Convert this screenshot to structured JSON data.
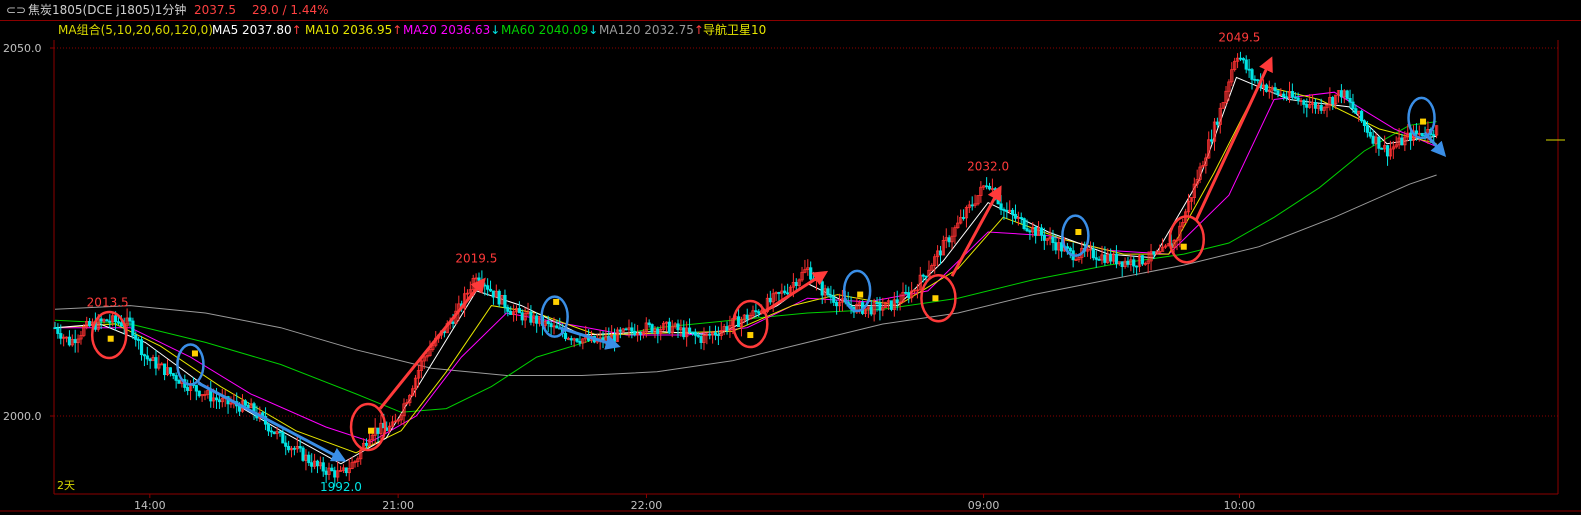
{
  "header": {
    "icon": "window-toggle-icon",
    "contract": "焦炭1805(DCE j1805)1分钟",
    "last_price": "2037.5",
    "change": "29.0 / 1.44%"
  },
  "indicators": {
    "group_label": "MA组合(5,10,20,60,120,0)",
    "ma5": "MA5 2037.80",
    "ma5_arrow": "↑",
    "ma10": "MA10 2036.95",
    "ma10_arrow": "↑",
    "ma20": "MA20 2036.63",
    "ma20_arrow": "↓",
    "ma60": "MA60 2040.09",
    "ma60_arrow": "↓",
    "ma120": "MA120 2032.75",
    "ma120_arrow": "↑",
    "nav_label": "导航卫星10"
  },
  "footer": {
    "period_label": "2天"
  },
  "colors": {
    "up": "#ff3232",
    "down": "#00e5e5",
    "ma5": "#ffffff",
    "ma10": "#e6e600",
    "ma20": "#ff00ff",
    "ma60": "#00d000",
    "ma120": "#9a9a9a",
    "axis": "#8b0000",
    "red_annotation": "#ff3a3a",
    "blue_annotation": "#3a8ee6",
    "title_red": "#ff4040",
    "label_yellow": "#d8d800"
  },
  "chart_data": {
    "type": "candlestick",
    "title": "焦炭1805(DCE j1805)1分钟",
    "ylim": [
      1988,
      2054
    ],
    "y_ticks": [
      {
        "value": 2050,
        "label": "2050.0"
      },
      {
        "value": 2000,
        "label": "2000.0"
      }
    ],
    "x_ticks": [
      {
        "pos": 0.063,
        "label": "14:00"
      },
      {
        "pos": 0.228,
        "label": "21:00"
      },
      {
        "pos": 0.393,
        "label": "22:00"
      },
      {
        "pos": 0.617,
        "label": "09:00"
      },
      {
        "pos": 0.787,
        "label": "10:00"
      }
    ],
    "price_path": [
      [
        0.0,
        2012
      ],
      [
        0.01,
        2010
      ],
      [
        0.02,
        2012
      ],
      [
        0.035,
        2013
      ],
      [
        0.05,
        2012.5
      ],
      [
        0.06,
        2008
      ],
      [
        0.09,
        2004
      ],
      [
        0.11,
        2002
      ],
      [
        0.13,
        2001
      ],
      [
        0.15,
        1997
      ],
      [
        0.175,
        1993
      ],
      [
        0.19,
        1992
      ],
      [
        0.2,
        1994
      ],
      [
        0.21,
        1998
      ],
      [
        0.225,
        1998.5
      ],
      [
        0.235,
        2003
      ],
      [
        0.245,
        2008
      ],
      [
        0.26,
        2012
      ],
      [
        0.27,
        2015
      ],
      [
        0.28,
        2019.5
      ],
      [
        0.29,
        2017
      ],
      [
        0.305,
        2014
      ],
      [
        0.32,
        2013
      ],
      [
        0.34,
        2011
      ],
      [
        0.36,
        2010
      ],
      [
        0.375,
        2011
      ],
      [
        0.39,
        2012
      ],
      [
        0.41,
        2012
      ],
      [
        0.43,
        2010.5
      ],
      [
        0.445,
        2012
      ],
      [
        0.465,
        2014
      ],
      [
        0.485,
        2017
      ],
      [
        0.5,
        2020
      ],
      [
        0.51,
        2017
      ],
      [
        0.525,
        2015
      ],
      [
        0.54,
        2014.5
      ],
      [
        0.555,
        2015
      ],
      [
        0.57,
        2017
      ],
      [
        0.59,
        2023
      ],
      [
        0.61,
        2029
      ],
      [
        0.62,
        2032
      ],
      [
        0.63,
        2028
      ],
      [
        0.645,
        2026
      ],
      [
        0.66,
        2024
      ],
      [
        0.675,
        2022
      ],
      [
        0.69,
        2022
      ],
      [
        0.71,
        2021
      ],
      [
        0.72,
        2021
      ],
      [
        0.735,
        2022
      ],
      [
        0.745,
        2024
      ],
      [
        0.755,
        2030
      ],
      [
        0.765,
        2036
      ],
      [
        0.775,
        2042
      ],
      [
        0.785,
        2049.5
      ],
      [
        0.795,
        2046
      ],
      [
        0.81,
        2044
      ],
      [
        0.825,
        2043
      ],
      [
        0.84,
        2042
      ],
      [
        0.855,
        2044
      ],
      [
        0.865,
        2041
      ],
      [
        0.875,
        2038
      ],
      [
        0.885,
        2036
      ],
      [
        0.9,
        2038
      ],
      [
        0.918,
        2039
      ]
    ],
    "ma5_path": [
      [
        0.0,
        2012
      ],
      [
        0.03,
        2012.5
      ],
      [
        0.06,
        2010
      ],
      [
        0.1,
        2004
      ],
      [
        0.15,
        1998
      ],
      [
        0.19,
        1993.5
      ],
      [
        0.22,
        1997
      ],
      [
        0.25,
        2007
      ],
      [
        0.28,
        2017
      ],
      [
        0.31,
        2015
      ],
      [
        0.35,
        2011
      ],
      [
        0.4,
        2011.5
      ],
      [
        0.44,
        2011
      ],
      [
        0.48,
        2015
      ],
      [
        0.5,
        2018
      ],
      [
        0.53,
        2015
      ],
      [
        0.56,
        2015
      ],
      [
        0.59,
        2021
      ],
      [
        0.62,
        2029
      ],
      [
        0.66,
        2025
      ],
      [
        0.7,
        2022
      ],
      [
        0.73,
        2021.5
      ],
      [
        0.76,
        2032
      ],
      [
        0.785,
        2046
      ],
      [
        0.82,
        2043
      ],
      [
        0.86,
        2042
      ],
      [
        0.885,
        2037
      ],
      [
        0.918,
        2038
      ]
    ],
    "ma10_path": [
      [
        0.0,
        2012
      ],
      [
        0.04,
        2012.5
      ],
      [
        0.07,
        2009.5
      ],
      [
        0.11,
        2004
      ],
      [
        0.16,
        1998
      ],
      [
        0.2,
        1995
      ],
      [
        0.23,
        1998
      ],
      [
        0.26,
        2006
      ],
      [
        0.29,
        2015
      ],
      [
        0.32,
        2014
      ],
      [
        0.36,
        2011
      ],
      [
        0.41,
        2011.3
      ],
      [
        0.45,
        2011.5
      ],
      [
        0.49,
        2015
      ],
      [
        0.52,
        2016.5
      ],
      [
        0.56,
        2015
      ],
      [
        0.6,
        2020
      ],
      [
        0.63,
        2027
      ],
      [
        0.67,
        2024
      ],
      [
        0.71,
        2022
      ],
      [
        0.74,
        2022
      ],
      [
        0.77,
        2033
      ],
      [
        0.8,
        2045
      ],
      [
        0.84,
        2043
      ],
      [
        0.88,
        2039
      ],
      [
        0.918,
        2037
      ]
    ],
    "ma20_path": [
      [
        0.0,
        2012
      ],
      [
        0.05,
        2012
      ],
      [
        0.09,
        2008
      ],
      [
        0.13,
        2003
      ],
      [
        0.18,
        1998.5
      ],
      [
        0.21,
        1996.5
      ],
      [
        0.24,
        2000
      ],
      [
        0.27,
        2008
      ],
      [
        0.3,
        2014
      ],
      [
        0.34,
        2012.5
      ],
      [
        0.38,
        2011
      ],
      [
        0.42,
        2011
      ],
      [
        0.46,
        2012
      ],
      [
        0.5,
        2016
      ],
      [
        0.54,
        2015.5
      ],
      [
        0.58,
        2017
      ],
      [
        0.62,
        2025
      ],
      [
        0.66,
        2024.5
      ],
      [
        0.7,
        2022.5
      ],
      [
        0.74,
        2022
      ],
      [
        0.78,
        2030
      ],
      [
        0.81,
        2043
      ],
      [
        0.85,
        2044
      ],
      [
        0.89,
        2039
      ],
      [
        0.918,
        2036.6
      ]
    ],
    "ma60_path": [
      [
        0.0,
        2013
      ],
      [
        0.05,
        2012.5
      ],
      [
        0.1,
        2010
      ],
      [
        0.15,
        2007
      ],
      [
        0.2,
        2003
      ],
      [
        0.23,
        2000.5
      ],
      [
        0.26,
        2001
      ],
      [
        0.29,
        2004
      ],
      [
        0.32,
        2008
      ],
      [
        0.36,
        2010.5
      ],
      [
        0.4,
        2012
      ],
      [
        0.45,
        2013
      ],
      [
        0.5,
        2014
      ],
      [
        0.55,
        2014.5
      ],
      [
        0.6,
        2016
      ],
      [
        0.65,
        2018.5
      ],
      [
        0.7,
        2020.5
      ],
      [
        0.75,
        2022
      ],
      [
        0.78,
        2023.5
      ],
      [
        0.81,
        2027
      ],
      [
        0.84,
        2031
      ],
      [
        0.87,
        2036
      ],
      [
        0.9,
        2039.5
      ],
      [
        0.918,
        2040
      ]
    ],
    "ma120_path": [
      [
        0.0,
        2014.5
      ],
      [
        0.05,
        2015
      ],
      [
        0.1,
        2014
      ],
      [
        0.15,
        2012
      ],
      [
        0.2,
        2009
      ],
      [
        0.25,
        2006.5
      ],
      [
        0.3,
        2005.5
      ],
      [
        0.35,
        2005.5
      ],
      [
        0.4,
        2006
      ],
      [
        0.45,
        2007.5
      ],
      [
        0.5,
        2010
      ],
      [
        0.55,
        2012.5
      ],
      [
        0.6,
        2014
      ],
      [
        0.65,
        2016.5
      ],
      [
        0.7,
        2018.5
      ],
      [
        0.75,
        2020.5
      ],
      [
        0.8,
        2023
      ],
      [
        0.85,
        2027
      ],
      [
        0.9,
        2031.5
      ],
      [
        0.918,
        2032.75
      ]
    ],
    "annotations": [
      {
        "x": 0.035,
        "y": 2013.5,
        "label": "2013.5"
      },
      {
        "x": 0.28,
        "y": 2019.5,
        "label": "2019.5"
      },
      {
        "x": 0.62,
        "y": 2032.0,
        "label": "2032.0"
      },
      {
        "x": 0.787,
        "y": 2049.5,
        "label": "2049.5"
      },
      {
        "x": 0.19,
        "y": 1992.0,
        "label": "1992.0",
        "below": true
      }
    ],
    "red_circles": [
      {
        "x": 0.036,
        "y": 2011
      },
      {
        "x": 0.208,
        "y": 1998.5
      },
      {
        "x": 0.462,
        "y": 2012.5
      },
      {
        "x": 0.587,
        "y": 2016
      },
      {
        "x": 0.752,
        "y": 2024
      }
    ],
    "blue_circles": [
      {
        "x": 0.09,
        "y": 2007
      },
      {
        "x": 0.332,
        "y": 2013.5
      },
      {
        "x": 0.533,
        "y": 2017
      },
      {
        "x": 0.678,
        "y": 2024.5
      },
      {
        "x": 0.908,
        "y": 2040.5
      }
    ],
    "red_arrows": [
      {
        "from": [
          0.216,
          2001
        ],
        "to": [
          0.285,
          2018.5
        ]
      },
      {
        "from": [
          0.47,
          2014
        ],
        "to": [
          0.512,
          2019.5
        ]
      },
      {
        "from": [
          0.596,
          2019
        ],
        "to": [
          0.628,
          2031
        ]
      },
      {
        "from": [
          0.758,
          2026.5
        ],
        "to": [
          0.808,
          2048.5
        ]
      }
    ],
    "blue_arrows": [
      {
        "from": [
          0.095,
          2004.5
        ],
        "to": [
          0.192,
          1994
        ]
      },
      {
        "from": [
          0.335,
          2012
        ],
        "to": [
          0.374,
          2009.5
        ]
      },
      {
        "from": [
          0.91,
          2038.5
        ],
        "to": [
          0.923,
          2035.5
        ]
      }
    ],
    "yellow_markers": [
      {
        "x": 0.037,
        "y": 2010.5
      },
      {
        "x": 0.093,
        "y": 2008.5
      },
      {
        "x": 0.21,
        "y": 1998
      },
      {
        "x": 0.333,
        "y": 2015.5
      },
      {
        "x": 0.462,
        "y": 2011
      },
      {
        "x": 0.535,
        "y": 2016.5
      },
      {
        "x": 0.585,
        "y": 2016
      },
      {
        "x": 0.68,
        "y": 2025
      },
      {
        "x": 0.75,
        "y": 2023
      },
      {
        "x": 0.909,
        "y": 2040
      }
    ],
    "last_price_marker": 2037.5
  }
}
